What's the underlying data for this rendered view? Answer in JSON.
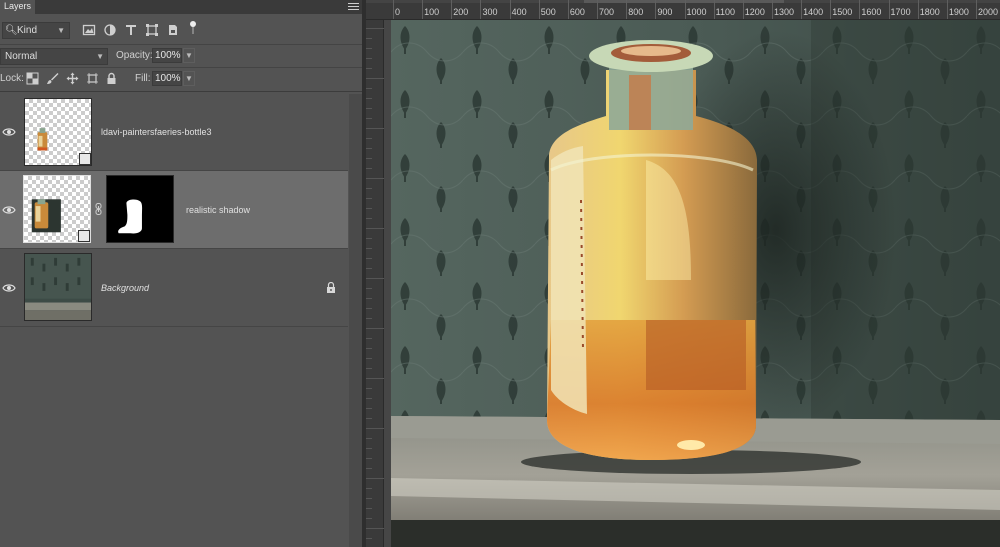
{
  "panel": {
    "tab_label": "Layers",
    "filter": {
      "kind_label": "Kind"
    },
    "blend_mode": "Normal",
    "opacity_label": "Opacity:",
    "opacity_value": "100%",
    "lock_label": "Lock:",
    "fill_label": "Fill:",
    "fill_value": "100%"
  },
  "layers": [
    {
      "name": "ldavi-paintersfaeries-bottle3",
      "visible": true,
      "selected": false
    },
    {
      "name": "realistic shadow",
      "visible": true,
      "selected": true
    },
    {
      "name": "Background",
      "visible": true,
      "selected": false,
      "locked": true
    }
  ],
  "ruler": {
    "labels": [
      "0",
      "100",
      "200",
      "300",
      "400",
      "500",
      "600",
      "700",
      "800",
      "900",
      "1000",
      "1100",
      "1200",
      "1300",
      "1400",
      "1500",
      "1600",
      "1700",
      "1800",
      "1900",
      "2000"
    ]
  },
  "icons": [
    "search-icon",
    "image-filter-icon",
    "adjustment-filter-icon",
    "type-filter-icon",
    "shape-filter-icon",
    "smart-object-filter-icon",
    "filter-toggle-icon",
    "lock-transparent-icon",
    "lock-paint-icon",
    "lock-position-icon",
    "lock-artboard-icon",
    "lock-all-icon",
    "eye-icon",
    "link-icon",
    "lock-icon"
  ],
  "colors": {
    "panel_bg": "#535353",
    "selected_layer": "#6d6d6d",
    "ruler_bg": "#3a3a3a",
    "canvas_dark": "#2e3935"
  }
}
